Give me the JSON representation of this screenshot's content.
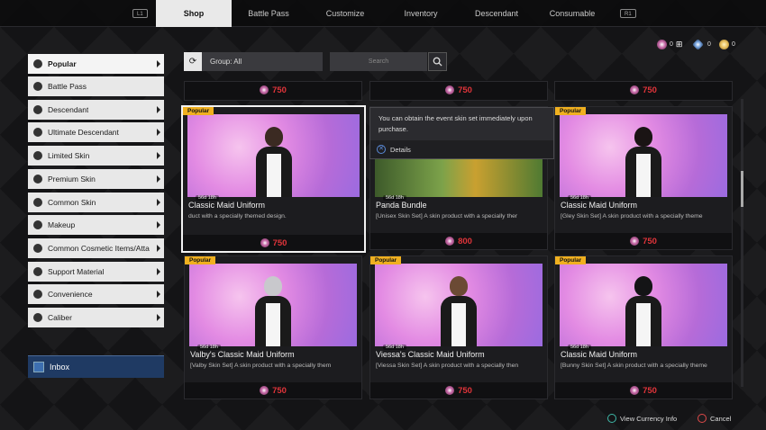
{
  "nav": {
    "left_hint": "L1",
    "right_hint": "R1",
    "tabs": [
      "Shop",
      "Battle Pass",
      "Customize",
      "Inventory",
      "Descendant",
      "Consumable"
    ]
  },
  "currency": [
    {
      "icon": "caliber-coin-icon",
      "value": "0",
      "color": "#c66aa7"
    },
    {
      "icon": "blue-crystal-icon",
      "value": "0",
      "color": "#7aa6e0"
    },
    {
      "icon": "gold-coin-icon",
      "value": "0",
      "color": "#e8c060"
    }
  ],
  "sidebar": {
    "items": [
      {
        "label": "Popular",
        "icon": "stars-icon"
      },
      {
        "label": "Battle Pass",
        "icon": "battle-pass-icon"
      },
      {
        "label": "Descendant",
        "icon": "descendant-icon"
      },
      {
        "label": "Ultimate Descendant",
        "icon": "ultimate-descendant-icon"
      },
      {
        "label": "Limited Skin",
        "icon": "shirt-icon"
      },
      {
        "label": "Premium Skin",
        "icon": "shirt-icon"
      },
      {
        "label": "Common Skin",
        "icon": "shirt-icon"
      },
      {
        "label": "Makeup",
        "icon": "brush-icon"
      },
      {
        "label": "Common Cosmetic Items/Atta",
        "icon": "wand-icon"
      },
      {
        "label": "Support Material",
        "icon": "material-icon"
      },
      {
        "label": "Convenience",
        "icon": "convenience-icon"
      },
      {
        "label": "Caliber",
        "icon": "caliber-icon"
      }
    ],
    "inbox": "Inbox"
  },
  "filter": {
    "group_label": "Group: All",
    "search_placeholder": "Search"
  },
  "top_row_prices": [
    "750",
    "750",
    "750"
  ],
  "cards": [
    {
      "badge": "Popular",
      "timer": "56d 18h",
      "name": "Classic Maid Uniform",
      "desc": "duct with a specially themed design.",
      "price": "750",
      "hair": "#3b2a22"
    },
    {
      "badge": "",
      "timer": "56d 18h",
      "name": "Panda Bundle",
      "desc": "[Unisex Skin Set] A skin product with a specially ther",
      "price": "800",
      "hair": ""
    },
    {
      "badge": "Popular",
      "timer": "56d 18h",
      "name": "Classic Maid Uniform",
      "desc": "[Gley Skin Set] A skin product with a specially theme",
      "price": "750",
      "hair": "#1a1414"
    },
    {
      "badge": "Popular",
      "timer": "56d 18h",
      "name": "Valby's Classic Maid Uniform",
      "desc": "[Valby Skin Set] A skin product with a specially them",
      "price": "750",
      "hair": "#c8c8cc"
    },
    {
      "badge": "Popular",
      "timer": "56d 18h",
      "name": "Viessa's Classic Maid Uniform",
      "desc": "[Viessa Skin Set] A skin product with a specially then",
      "price": "750",
      "hair": "#6b4a34"
    },
    {
      "badge": "Popular",
      "timer": "56d 18h",
      "name": "Classic Maid Uniform",
      "desc": "[Bunny Skin Set] A skin product with a specially theme",
      "price": "750",
      "hair": "#141416"
    }
  ],
  "tooltip": {
    "text": "You can obtain the event skin set immediately upon purchase.",
    "details": "Details"
  },
  "footer": {
    "view_currency": "View Currency Info",
    "cancel": "Cancel"
  }
}
